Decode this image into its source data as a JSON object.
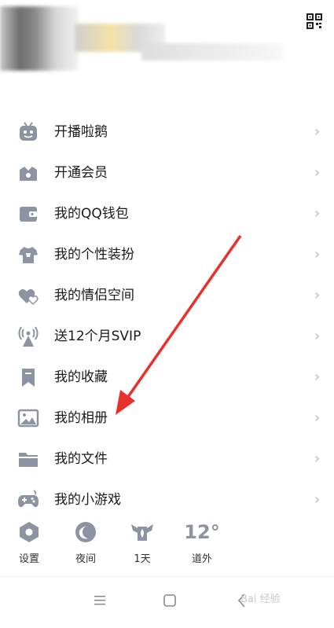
{
  "menu": {
    "items": [
      {
        "label": "开播啦鹅",
        "icon": "live-penguin-icon"
      },
      {
        "label": "开通会员",
        "icon": "crown-icon"
      },
      {
        "label": "我的QQ钱包",
        "icon": "wallet-icon"
      },
      {
        "label": "我的个性装扮",
        "icon": "tshirt-icon"
      },
      {
        "label": "我的情侣空间",
        "icon": "hearts-icon"
      },
      {
        "label": "送12个月SVIP",
        "icon": "broadcast-tower-icon"
      },
      {
        "label": "我的收藏",
        "icon": "bookmark-icon"
      },
      {
        "label": "我的相册",
        "icon": "photo-icon"
      },
      {
        "label": "我的文件",
        "icon": "folder-icon"
      },
      {
        "label": "我的小游戏",
        "icon": "gamepad-icon"
      }
    ]
  },
  "quickbar": {
    "settings": "设置",
    "night": "夜间",
    "streak": "1天",
    "temperature": "12°",
    "weather_location": "道外"
  },
  "watermark": "Bai 经验",
  "colors": {
    "icon": "#8e93a3",
    "arrow": "#e8312b"
  }
}
